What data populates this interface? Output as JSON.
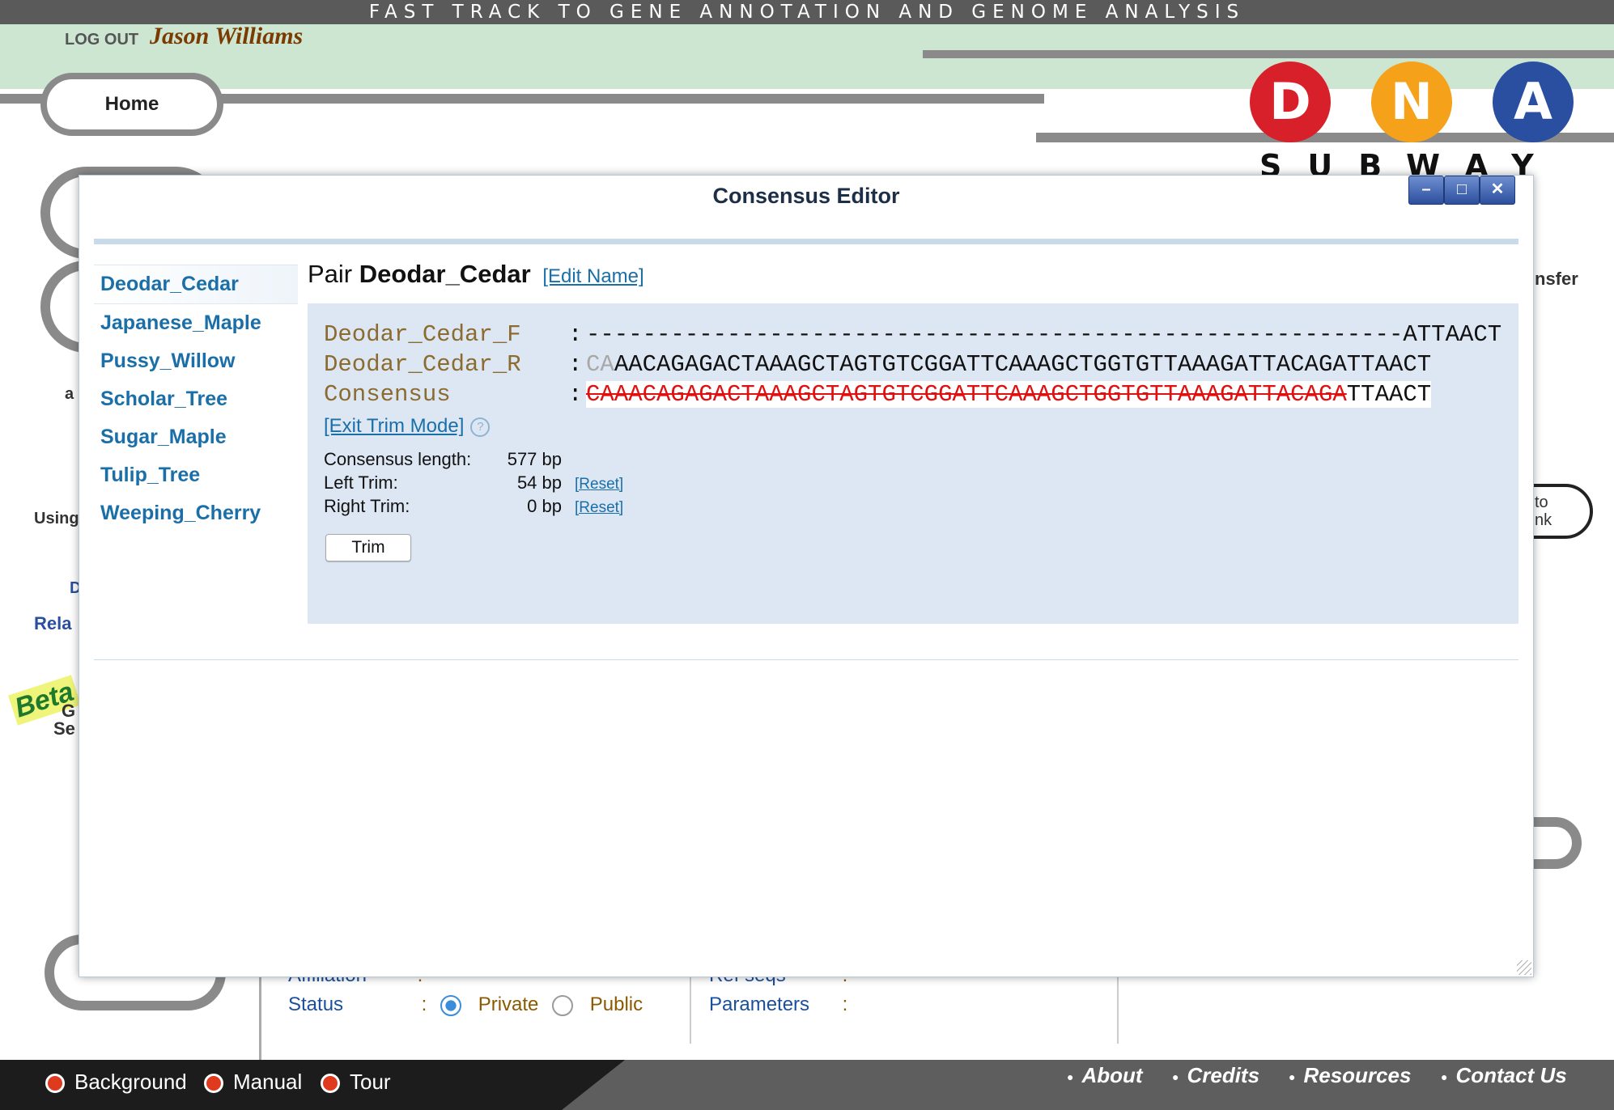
{
  "header": {
    "banner": "FAST TRACK TO GENE ANNOTATION AND GENOME ANALYSIS",
    "logout_label": "LOG OUT",
    "username": "Jason Williams",
    "home_label": "Home"
  },
  "logo": {
    "letters": [
      "D",
      "N",
      "A"
    ],
    "colors": [
      "#d8202a",
      "#f5a21a",
      "#2a4fa0"
    ],
    "subtitle": "SUBWAY"
  },
  "background_fragments": {
    "left_a": "a",
    "left_using": "Using",
    "left_d": "D",
    "left_rela": "Rela",
    "beta": "Beta",
    "left_g": "G",
    "left_se": "Se",
    "right_transfer": "nsfer",
    "right_to": "to",
    "right_nk": "nk"
  },
  "background_panel": {
    "affiliation_label": "Affiliation",
    "affiliation_sep": ": -",
    "status_label": "Status",
    "status_sep": ":",
    "private_label": "Private",
    "public_label": "Public",
    "refseqs_label": "Ref seqs",
    "refseqs_sep": ":",
    "parameters_label": "Parameters",
    "parameters_sep": ":"
  },
  "footer": {
    "left_links": [
      "Background",
      "Manual",
      "Tour"
    ],
    "right_links": [
      "About",
      "Credits",
      "Resources",
      "Contact Us"
    ]
  },
  "dialog": {
    "title": "Consensus Editor",
    "window_buttons": [
      "minimize-icon",
      "maximize-icon",
      "close-icon"
    ],
    "sidebar_items": [
      "Deodar_Cedar",
      "Japanese_Maple",
      "Pussy_Willow",
      "Scholar_Tree",
      "Sugar_Maple",
      "Tulip_Tree",
      "Weeping_Cherry"
    ],
    "selected_index": 0,
    "pair_prefix": "Pair",
    "pair_name": "Deodar_Cedar",
    "edit_name_label": "[Edit Name]",
    "sequences": [
      {
        "name": "Deodar_Cedar_F",
        "gray": "",
        "red": "",
        "data": "----------------------------------------------------------ATTAACT"
      },
      {
        "name": "Deodar_Cedar_R",
        "gray": "CA",
        "red": "",
        "data": "AACAGAGACTAAAGCTAGTGTCGGATTCAAAGCTGGTGTTAAAGATTACAGATTAACT"
      },
      {
        "name": "Consensus",
        "gray": "",
        "red": "CAAACAGAGACTAAAGCTAGTGTCGGATTCAAAGCTGGTGTTAAAGATTACAGA",
        "data": "TTAACT"
      }
    ],
    "colon": ":",
    "exit_trim_label": "[Exit Trim Mode]",
    "help_icon": "question-circle-icon",
    "stats": {
      "consensus_length_label": "Consensus length:",
      "consensus_length_value": "577 bp",
      "left_trim_label": "Left Trim:",
      "left_trim_value": "54 bp",
      "right_trim_label": "Right Trim:",
      "right_trim_value": "0 bp",
      "reset_label": "[Reset]"
    },
    "trim_button_label": "Trim"
  }
}
